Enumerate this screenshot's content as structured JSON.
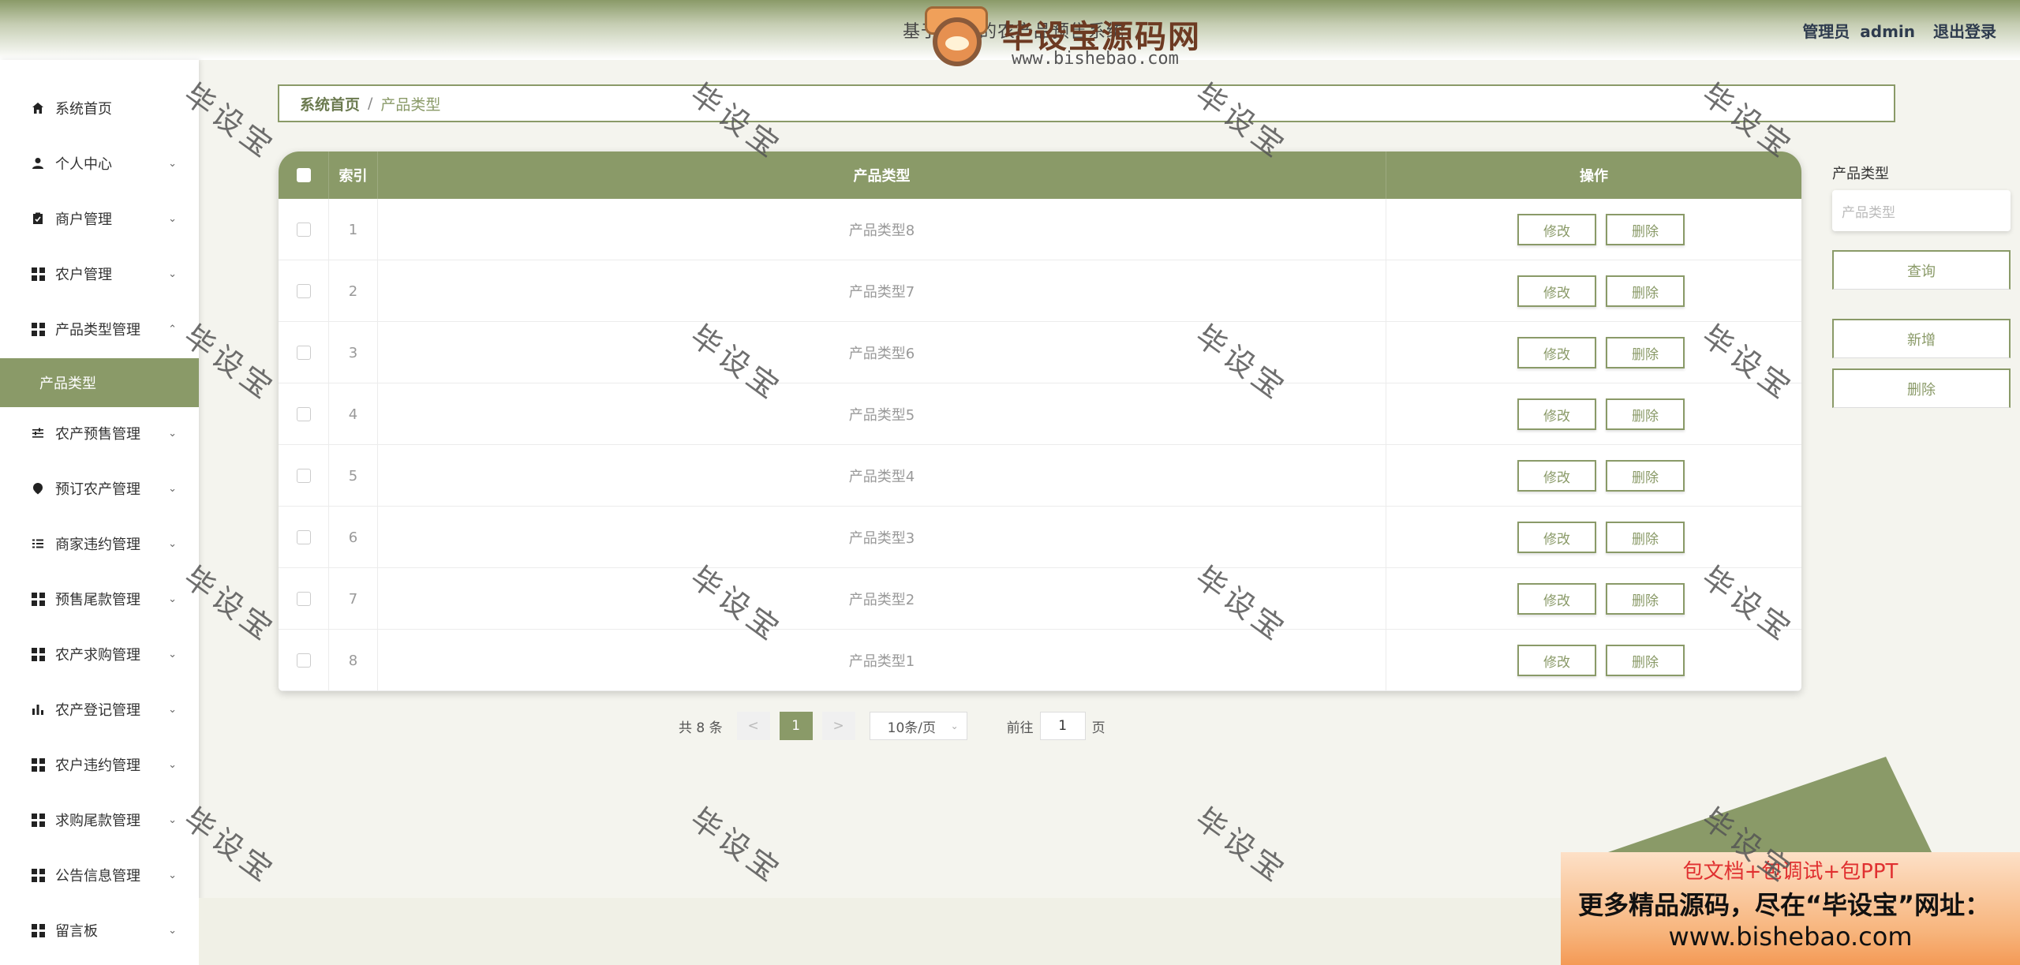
{
  "app": {
    "title": "基于Web的农产品预售系统",
    "user_prefix": "管理员",
    "username": "admin",
    "logout": "退出登录"
  },
  "logo": {
    "name": "毕设宝源码网",
    "url": "www.bishebao.com"
  },
  "sidebar": {
    "items": [
      {
        "label": "系统首页",
        "icon": "home-icon"
      },
      {
        "label": "个人中心",
        "icon": "user-icon"
      },
      {
        "label": "商户管理",
        "icon": "clipboard-icon"
      },
      {
        "label": "农户管理",
        "icon": "grid-icon"
      },
      {
        "label": "产品类型管理",
        "icon": "grid-icon"
      },
      {
        "label": "农产预售管理",
        "icon": "sliders-icon"
      },
      {
        "label": "预订农产管理",
        "icon": "pin-icon"
      },
      {
        "label": "商家违约管理",
        "icon": "list-icon"
      },
      {
        "label": "预售尾款管理",
        "icon": "grid-icon"
      },
      {
        "label": "农产求购管理",
        "icon": "grid-icon"
      },
      {
        "label": "农产登记管理",
        "icon": "bar-chart-icon"
      },
      {
        "label": "农户违约管理",
        "icon": "grid-icon"
      },
      {
        "label": "求购尾款管理",
        "icon": "grid-icon"
      },
      {
        "label": "公告信息管理",
        "icon": "grid-icon"
      },
      {
        "label": "留言板",
        "icon": "grid-icon"
      }
    ],
    "active_sub": "产品类型"
  },
  "breadcrumb": {
    "home": "系统首页",
    "separator": "/",
    "current": "产品类型"
  },
  "table": {
    "headers": {
      "index": "索引",
      "type": "产品类型",
      "actions": "操作"
    },
    "rows": [
      {
        "index": "1",
        "type": "产品类型8"
      },
      {
        "index": "2",
        "type": "产品类型7"
      },
      {
        "index": "3",
        "type": "产品类型6"
      },
      {
        "index": "4",
        "type": "产品类型5"
      },
      {
        "index": "5",
        "type": "产品类型4"
      },
      {
        "index": "6",
        "type": "产品类型3"
      },
      {
        "index": "7",
        "type": "产品类型2"
      },
      {
        "index": "8",
        "type": "产品类型1"
      }
    ],
    "edit_label": "修改",
    "delete_label": "删除"
  },
  "pager": {
    "total": "共 8 条",
    "prev": "<",
    "current": "1",
    "next": ">",
    "page_size": "10条/页",
    "goto_prefix": "前往",
    "goto_value": "1",
    "goto_suffix": "页"
  },
  "search": {
    "label": "产品类型",
    "placeholder": "产品类型",
    "query_button": "查询",
    "add_button": "新增",
    "delete_button": "删除"
  },
  "promo": {
    "line1": "包文档+包调试+包PPT",
    "line2": "更多精品源码，尽在“毕设宝”网址：",
    "line3": "www.bishebao.com"
  },
  "watermark": "毕设宝",
  "colors": {
    "accent": "#8a9a68",
    "promo_red": "#e03030"
  }
}
